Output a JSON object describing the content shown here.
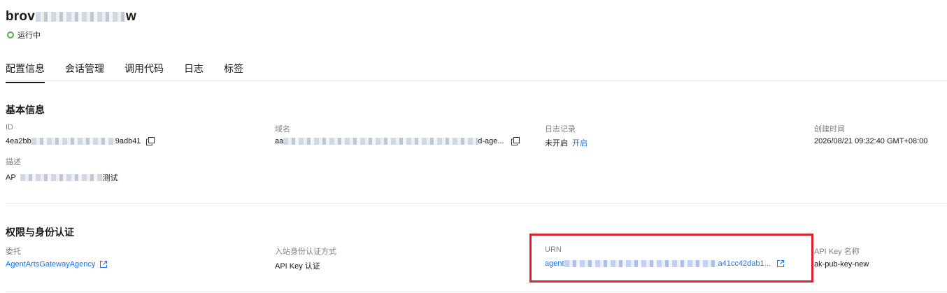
{
  "header": {
    "title_start": "brov",
    "title_end": "w",
    "status": "运行中"
  },
  "tabs": [
    {
      "label": "配置信息",
      "active": true
    },
    {
      "label": "会话管理",
      "active": false
    },
    {
      "label": "调用代码",
      "active": false
    },
    {
      "label": "日志",
      "active": false
    },
    {
      "label": "标签",
      "active": false
    }
  ],
  "basic_info": {
    "title": "基本信息",
    "id": {
      "label": "ID",
      "value_start": "4ea2bb",
      "value_end": "9adb41"
    },
    "domain": {
      "label": "域名",
      "value_start": "aa",
      "value_end": "d-age..."
    },
    "log": {
      "label": "日志记录",
      "value": "未开启",
      "action": "开启"
    },
    "created": {
      "label": "创建时间",
      "value": "2026/08/21 09:32:40 GMT+08:00"
    },
    "description": {
      "label": "描述",
      "value_start": "AP",
      "value_end": "测试"
    }
  },
  "auth": {
    "title": "权限与身份认证",
    "delegate": {
      "label": "委托",
      "value": "AgentArtsGatewayAgency"
    },
    "inbound": {
      "label": "入站身份认证方式",
      "value": "API Key 认证"
    },
    "urn": {
      "label": "URN",
      "value_start": "agent",
      "value_end": "a41cc42dab1..."
    },
    "apikey": {
      "label": "API Key 名称",
      "value": "ak-pub-key-new"
    }
  },
  "colors": {
    "accent": "#1a73e8",
    "status_ok": "#4caf50",
    "highlight": "#e0202e"
  }
}
